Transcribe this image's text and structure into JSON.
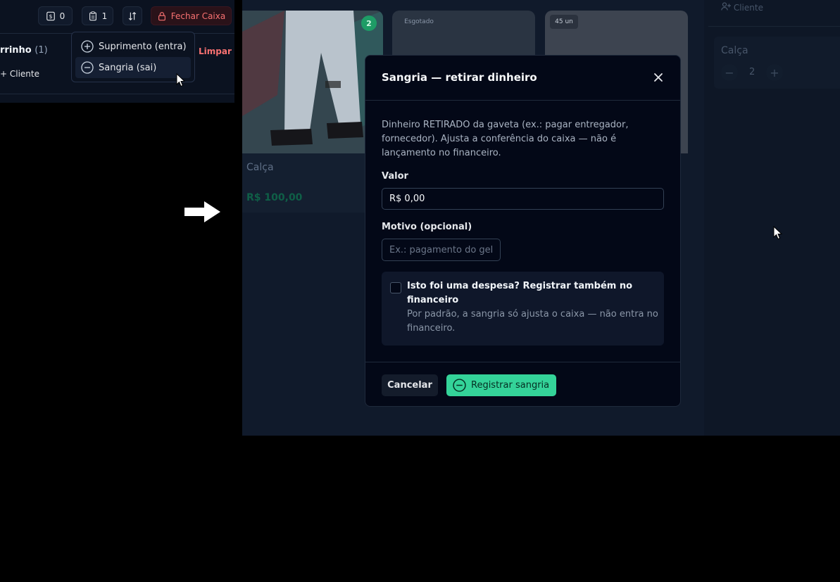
{
  "toolbar": {
    "cash_count": "0",
    "notes_count": "1",
    "close_register_label": "Fechar Caixa"
  },
  "cart": {
    "title": "rrinho",
    "count": "(1)",
    "clear_label": "Limpar",
    "client_label": "Cliente"
  },
  "cash_menu": {
    "items": [
      {
        "label": "Suprimento (entra)",
        "icon": "plus-circle-icon"
      },
      {
        "label": "Sangria (sai)",
        "icon": "minus-circle-icon"
      }
    ]
  },
  "products": [
    {
      "name": "Calça",
      "price": "R$ 100,00",
      "badge": "2"
    },
    {
      "badge": "Esgotado"
    },
    {
      "badge": "45 un"
    }
  ],
  "side_cart": {
    "client_label": "Cliente",
    "item_name": "Calça",
    "quantity": "2"
  },
  "modal": {
    "title": "Sangria — retirar dinheiro",
    "description": "Dinheiro RETIRADO da gaveta (ex.: pagar entregador, fornecedor). Ajusta a conferência do caixa — não é lançamento no financeiro.",
    "valor_label": "Valor",
    "valor_value": "R$ 0,00",
    "motivo_label": "Motivo (opcional)",
    "motivo_placeholder": "Ex.: pagamento do gelo",
    "expense_title": "Isto foi uma despesa? Registrar também no financeiro",
    "expense_sub": "Por padrão, a sangria só ajusta o caixa — não entra no financeiro.",
    "expense_checked": false,
    "cancel_label": "Cancelar",
    "confirm_label": "Registrar sangria"
  },
  "colors": {
    "accent": "#34d399",
    "danger": "#f87171",
    "background": "#030817"
  }
}
